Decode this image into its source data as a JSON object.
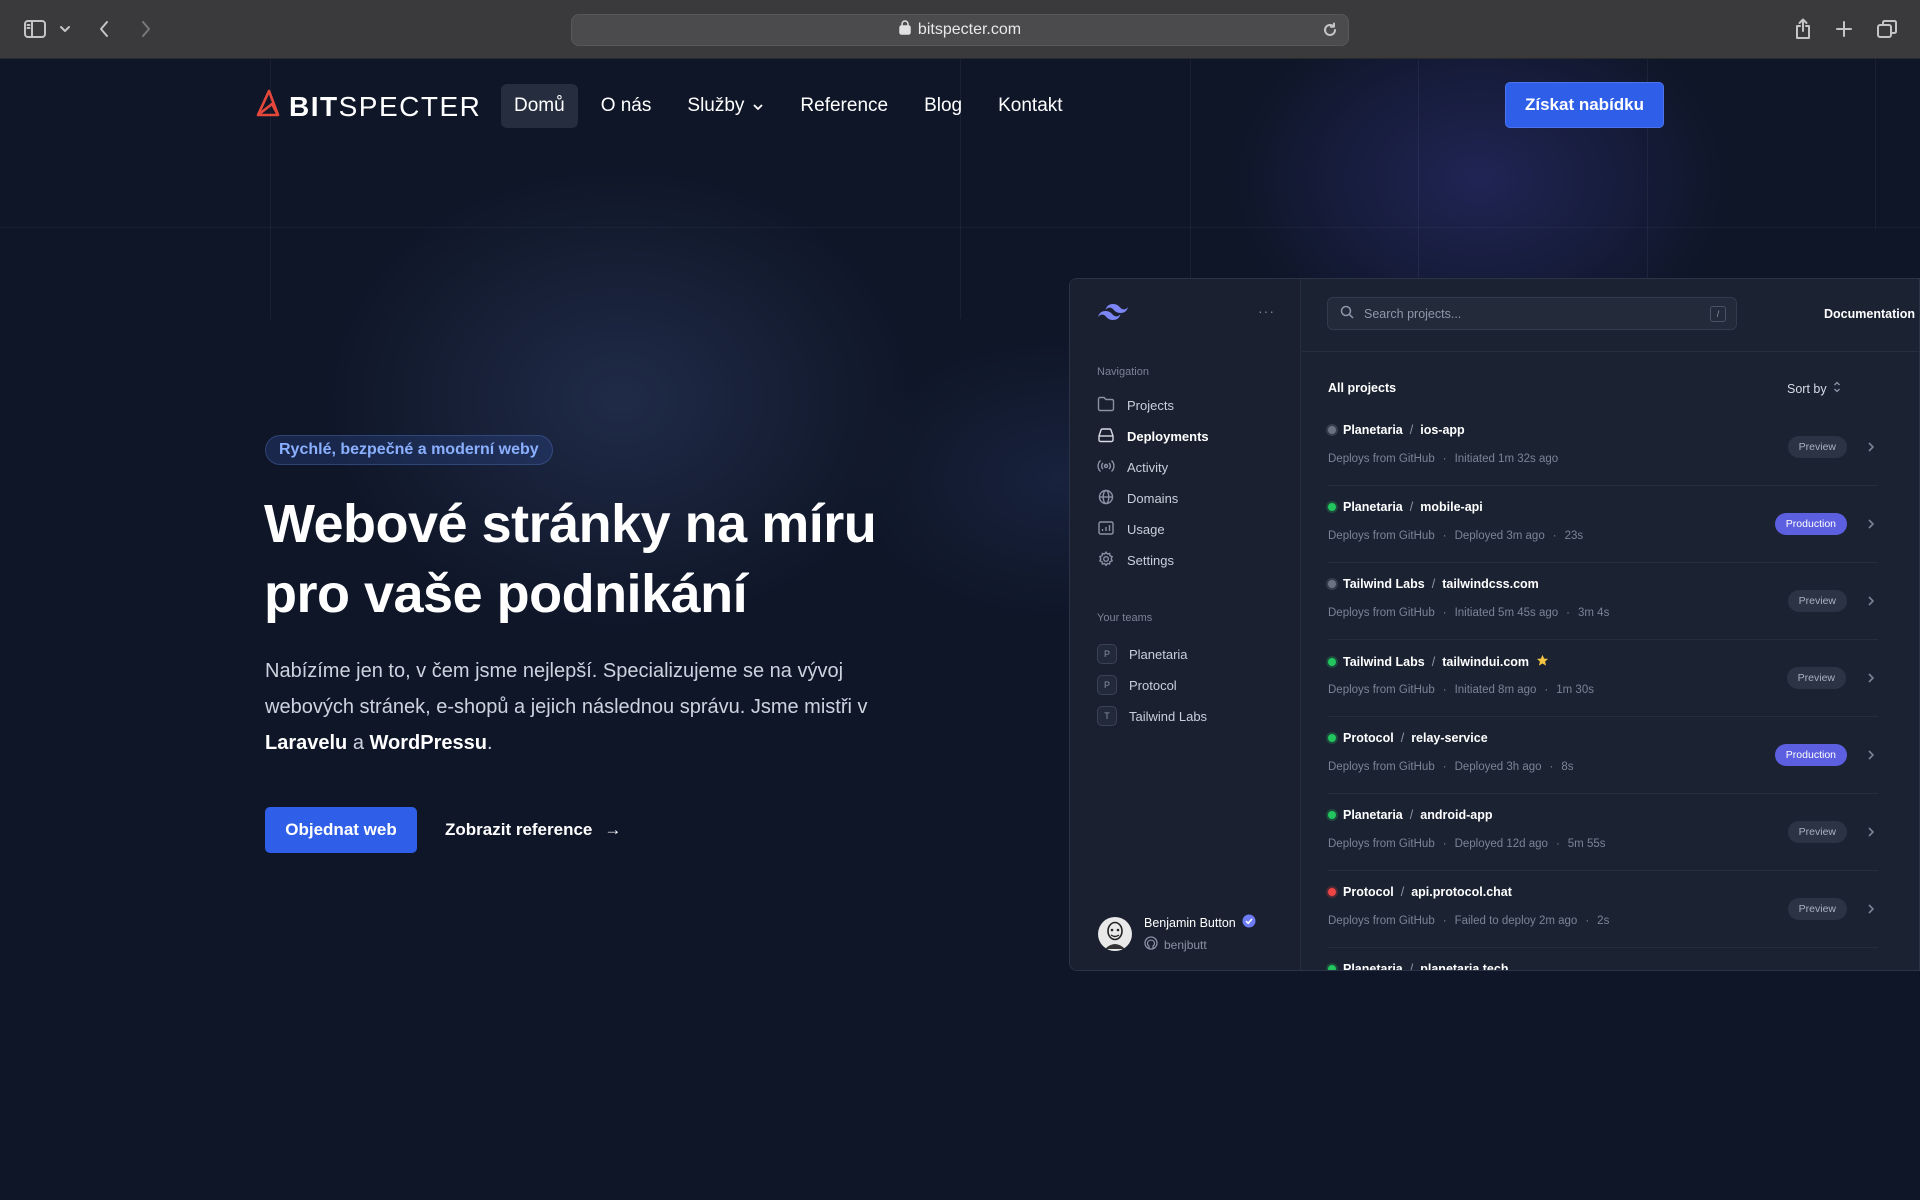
{
  "browser": {
    "url": "bitspecter.com"
  },
  "header": {
    "logo_bold": "BIT",
    "logo_light": "SPECTER",
    "nav": [
      {
        "label": "Domů",
        "active": true
      },
      {
        "label": "O nás"
      },
      {
        "label": "Služby",
        "dropdown": true
      },
      {
        "label": "Reference"
      },
      {
        "label": "Blog"
      },
      {
        "label": "Kontakt"
      }
    ],
    "cta": "Získat nabídku"
  },
  "hero": {
    "badge": "Rychlé, bezpečné a moderní weby",
    "title_line1": "Webové stránky na míru",
    "title_line2": "pro vaše podnikání",
    "text_part1": "Nabízíme jen to, v čem jsme nejlepší. Specializujeme se na vývoj webových stránek, e-shopů a jejich následnou správu. Jsme mistři v ",
    "text_strong1": "Laravelu",
    "text_and": " a ",
    "text_strong2": "WordPressu",
    "text_end": ".",
    "primary_button": "Objednat web",
    "secondary_button": "Zobrazit reference",
    "arrow": "→"
  },
  "app": {
    "more_dots": "···",
    "navigation_title": "Navigation",
    "navigation": [
      {
        "label": "Projects",
        "icon": "folder-icon"
      },
      {
        "label": "Deployments",
        "icon": "server-icon",
        "active": true
      },
      {
        "label": "Activity",
        "icon": "signal-icon"
      },
      {
        "label": "Domains",
        "icon": "globe-icon"
      },
      {
        "label": "Usage",
        "icon": "chart-icon"
      },
      {
        "label": "Settings",
        "icon": "gear-icon"
      }
    ],
    "teams_title": "Your teams",
    "teams": [
      {
        "initial": "P",
        "label": "Planetaria"
      },
      {
        "initial": "P",
        "label": "Protocol"
      },
      {
        "initial": "T",
        "label": "Tailwind Labs"
      }
    ],
    "user": {
      "name": "Benjamin Button",
      "handle": "benjbutt"
    },
    "search_placeholder": "Search projects...",
    "search_key": "/",
    "documentation": "Documentation",
    "all_projects": "All projects",
    "sort_by": "Sort by",
    "slash": "/",
    "projects": [
      {
        "team": "Planetaria",
        "name": "ios-app",
        "status": "gray",
        "meta": [
          "Deploys from GitHub",
          "·",
          "Initiated 1m 32s ago"
        ],
        "env": "Preview"
      },
      {
        "team": "Planetaria",
        "name": "mobile-api",
        "status": "green",
        "meta": [
          "Deploys from GitHub",
          "·",
          "Deployed 3m ago",
          "·",
          "23s"
        ],
        "env": "Production"
      },
      {
        "team": "Tailwind Labs",
        "name": "tailwindcss.com",
        "status": "gray",
        "meta": [
          "Deploys from GitHub",
          "·",
          "Initiated 5m 45s ago",
          "·",
          "3m 4s"
        ],
        "env": "Preview"
      },
      {
        "team": "Tailwind Labs",
        "name": "tailwindui.com",
        "status": "green",
        "star": true,
        "meta": [
          "Deploys from GitHub",
          "·",
          "Initiated 8m ago",
          "·",
          "1m 30s"
        ],
        "env": "Preview"
      },
      {
        "team": "Protocol",
        "name": "relay-service",
        "status": "green",
        "meta": [
          "Deploys from GitHub",
          "·",
          "Deployed 3h ago",
          "·",
          "8s"
        ],
        "env": "Production"
      },
      {
        "team": "Planetaria",
        "name": "android-app",
        "status": "green",
        "meta": [
          "Deploys from GitHub",
          "·",
          "Deployed 12d ago",
          "·",
          "5m 55s"
        ],
        "env": "Preview"
      },
      {
        "team": "Protocol",
        "name": "api.protocol.chat",
        "status": "red",
        "meta": [
          "Deploys from GitHub",
          "·",
          "Failed to deploy 2m ago",
          "·",
          "2s"
        ],
        "env": "Preview"
      },
      {
        "team": "Planetaria",
        "name": "planetaria.tech",
        "status": "green",
        "meta": [],
        "env": ""
      }
    ]
  },
  "colors": {
    "background": "#0f1628",
    "accent": "#2f5fe9",
    "production": "#5b5fe0",
    "status_green": "#22c55e",
    "status_gray": "#6b7280",
    "status_red": "#ef4444",
    "logo_red": "#e5483b"
  }
}
